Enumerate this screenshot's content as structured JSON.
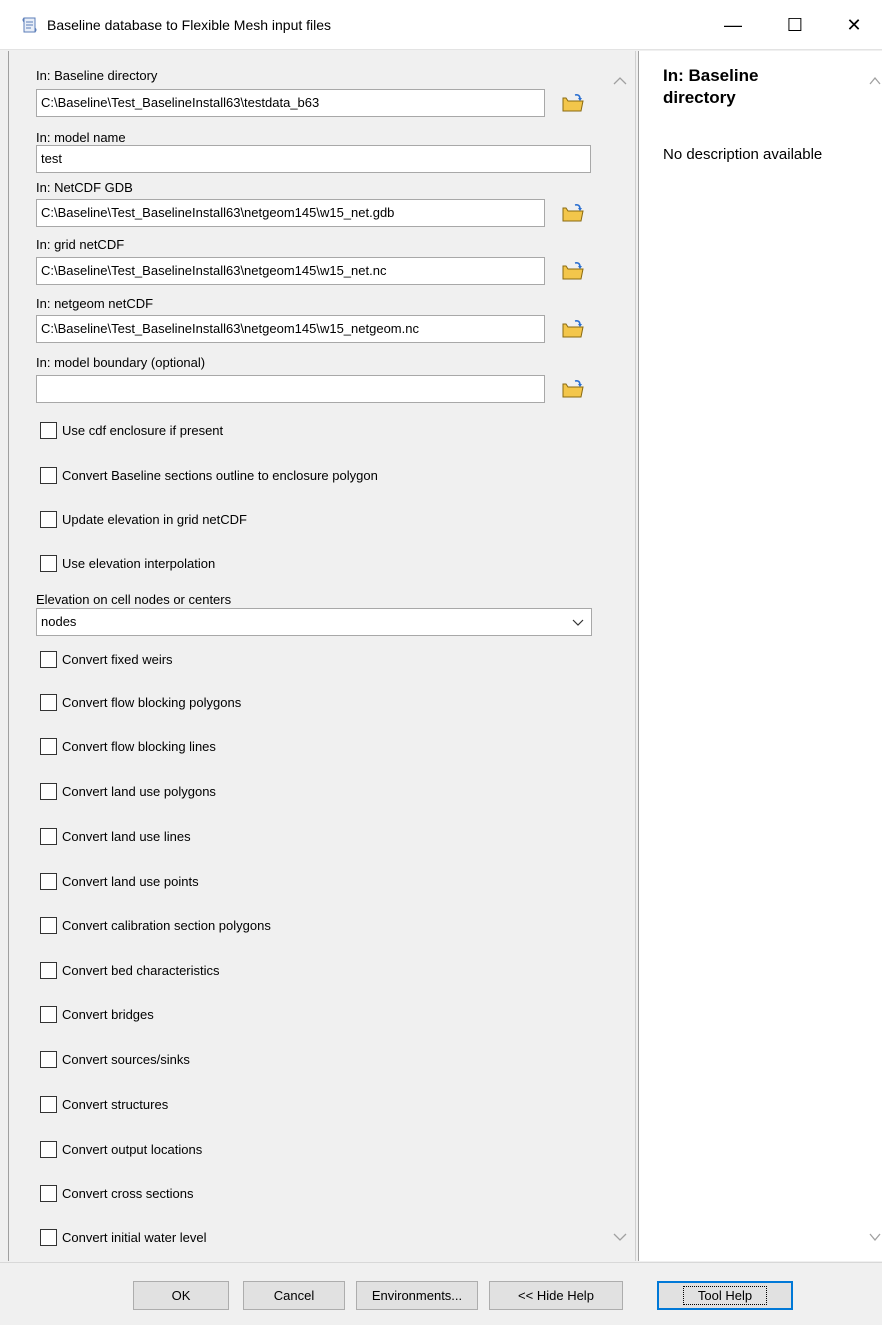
{
  "window": {
    "title": "Baseline database to Flexible Mesh input files",
    "min_glyph": "—",
    "max_glyph": "☐",
    "close_glyph": "✕"
  },
  "fields": {
    "baseline_dir": {
      "label": "In: Baseline directory",
      "value": "C:\\Baseline\\Test_BaselineInstall63\\testdata_b63"
    },
    "model_name": {
      "label": "In: model name",
      "value": "test"
    },
    "netcdf_gdb": {
      "label": "In: NetCDF GDB",
      "value": "C:\\Baseline\\Test_BaselineInstall63\\netgeom145\\w15_net.gdb"
    },
    "grid_netcdf": {
      "label": "In: grid netCDF",
      "value": "C:\\Baseline\\Test_BaselineInstall63\\netgeom145\\w15_net.nc"
    },
    "netgeom_netcdf": {
      "label": "In: netgeom netCDF",
      "value": "C:\\Baseline\\Test_BaselineInstall63\\netgeom145\\w15_netgeom.nc"
    },
    "model_boundary": {
      "label": "In: model boundary (optional)",
      "value": ""
    }
  },
  "checkboxes_top": [
    {
      "label": "Use cdf enclosure if present",
      "checked": false
    },
    {
      "label": "Convert Baseline sections outline to enclosure polygon",
      "checked": false
    },
    {
      "label": "Update elevation in grid netCDF",
      "checked": false
    },
    {
      "label": "Use elevation interpolation",
      "checked": false
    }
  ],
  "elevation": {
    "label": "Elevation on cell nodes or centers",
    "selected": "nodes"
  },
  "checkboxes_bottom": [
    {
      "label": "Convert fixed weirs",
      "checked": false
    },
    {
      "label": "Convert flow blocking polygons",
      "checked": false
    },
    {
      "label": "Convert flow blocking lines",
      "checked": false
    },
    {
      "label": "Convert land use polygons",
      "checked": false
    },
    {
      "label": "Convert land use lines",
      "checked": false
    },
    {
      "label": "Convert land use points",
      "checked": false
    },
    {
      "label": "Convert calibration section polygons",
      "checked": false
    },
    {
      "label": "Convert bed characteristics",
      "checked": false
    },
    {
      "label": "Convert bridges",
      "checked": false
    },
    {
      "label": "Convert sources/sinks",
      "checked": false
    },
    {
      "label": "Convert structures",
      "checked": false
    },
    {
      "label": "Convert output locations",
      "checked": false
    },
    {
      "label": "Convert cross sections",
      "checked": false
    },
    {
      "label": "Convert initial water level",
      "checked": false
    }
  ],
  "help": {
    "title": "In: Baseline directory",
    "description": "No description available"
  },
  "buttons": {
    "ok": "OK",
    "cancel": "Cancel",
    "environments": "Environments...",
    "hide_help": "<< Hide Help",
    "tool_help": "Tool Help"
  },
  "colors": {
    "folder_yellow": "#f3c64b",
    "focus_blue": "#0078d7"
  }
}
